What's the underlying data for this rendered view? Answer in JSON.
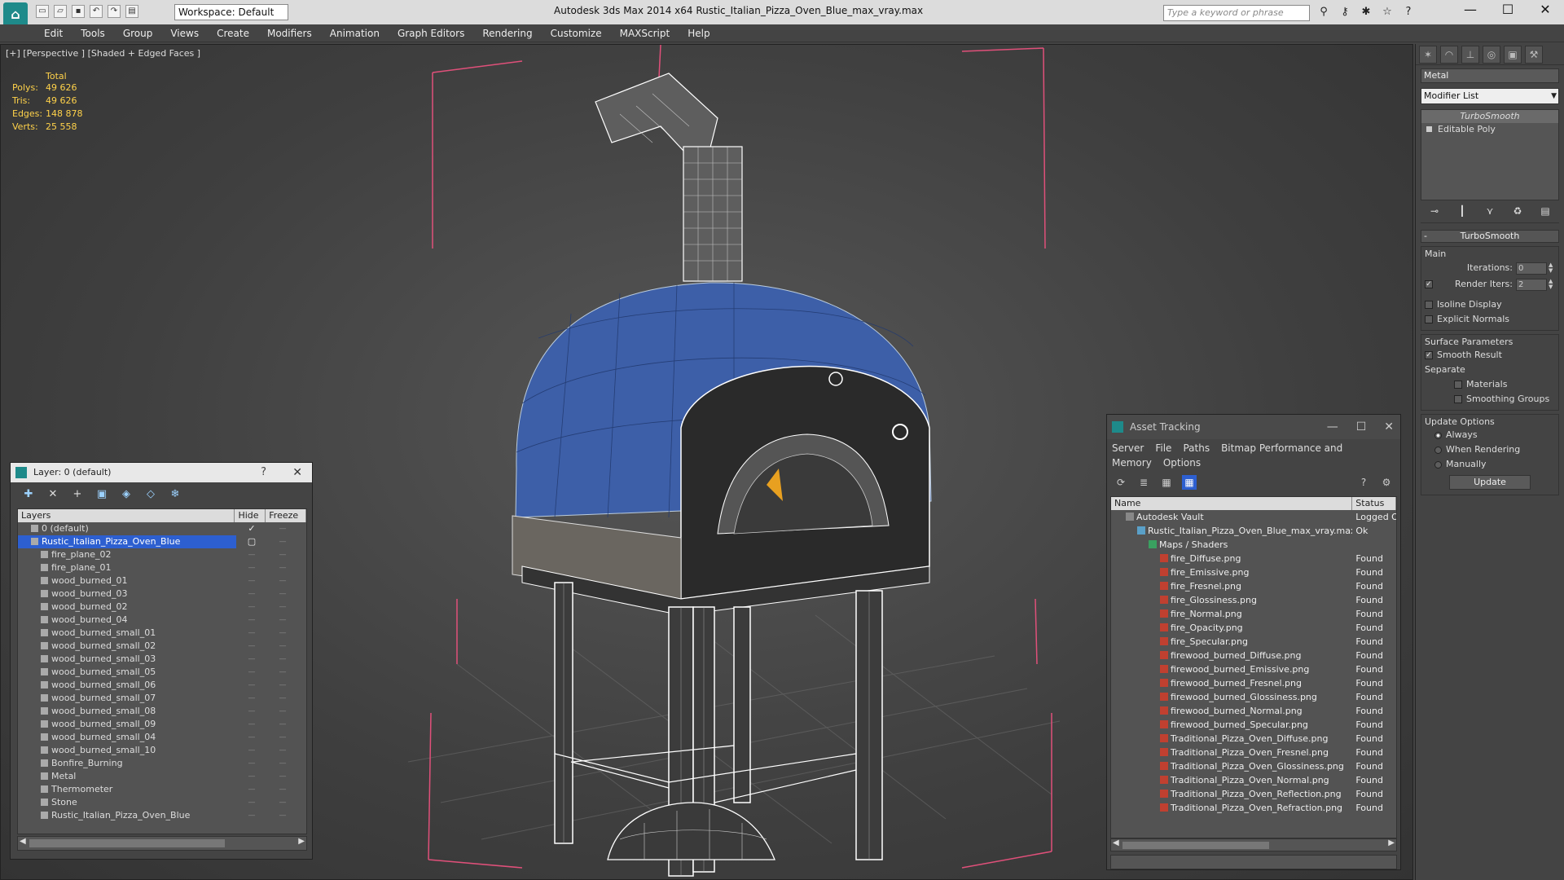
{
  "app": {
    "title": "Autodesk 3ds Max  2014 x64      Rustic_Italian_Pizza_Oven_Blue_max_vray.max",
    "workspace": "Workspace: Default",
    "search_placeholder": "Type a keyword or phrase"
  },
  "menu": [
    "Edit",
    "Tools",
    "Group",
    "Views",
    "Create",
    "Modifiers",
    "Animation",
    "Graph Editors",
    "Rendering",
    "Customize",
    "MAXScript",
    "Help"
  ],
  "viewport": {
    "label": "[+] [Perspective ] [Shaded + Edged Faces ]",
    "stats": {
      "header": "Total",
      "rows": [
        {
          "k": "Polys:",
          "v": "49 626"
        },
        {
          "k": "Tris:",
          "v": "49 626"
        },
        {
          "k": "Edges:",
          "v": "148 878"
        },
        {
          "k": "Verts:",
          "v": "25 558"
        }
      ]
    }
  },
  "command_panel": {
    "object_name": "Metal",
    "modifier_list": "Modifier List",
    "stack": [
      "TurboSmooth",
      "Editable Poly"
    ],
    "rollout": "TurboSmooth",
    "main_label": "Main",
    "iterations_label": "Iterations:",
    "iterations_value": "0",
    "render_iters_label": "Render Iters:",
    "render_iters_value": "2",
    "isoline": "Isoline Display",
    "explicit": "Explicit Normals",
    "surface_label": "Surface Parameters",
    "smooth_result": "Smooth Result",
    "separate": "Separate",
    "materials": "Materials",
    "smoothing_groups": "Smoothing Groups",
    "update_label": "Update Options",
    "always": "Always",
    "when_rendering": "When Rendering",
    "manually": "Manually",
    "update_btn": "Update"
  },
  "layer_window": {
    "title": "Layer: 0 (default)",
    "help": "?",
    "close": "✕",
    "col_layers": "Layers",
    "col_hide": "Hide",
    "col_freeze": "Freeze",
    "rows": [
      {
        "name": "0 (default)",
        "indent": 1,
        "kind": "layer",
        "hide": "✓"
      },
      {
        "name": "Rustic_Italian_Pizza_Oven_Blue",
        "indent": 1,
        "kind": "layer",
        "selected": true,
        "hide": "▢"
      },
      {
        "name": "fire_plane_02",
        "indent": 2
      },
      {
        "name": "fire_plane_01",
        "indent": 2
      },
      {
        "name": "wood_burned_01",
        "indent": 2
      },
      {
        "name": "wood_burned_03",
        "indent": 2
      },
      {
        "name": "wood_burned_02",
        "indent": 2
      },
      {
        "name": "wood_burned_04",
        "indent": 2
      },
      {
        "name": "wood_burned_small_01",
        "indent": 2
      },
      {
        "name": "wood_burned_small_02",
        "indent": 2
      },
      {
        "name": "wood_burned_small_03",
        "indent": 2
      },
      {
        "name": "wood_burned_small_05",
        "indent": 2
      },
      {
        "name": "wood_burned_small_06",
        "indent": 2
      },
      {
        "name": "wood_burned_small_07",
        "indent": 2
      },
      {
        "name": "wood_burned_small_08",
        "indent": 2
      },
      {
        "name": "wood_burned_small_09",
        "indent": 2
      },
      {
        "name": "wood_burned_small_04",
        "indent": 2
      },
      {
        "name": "wood_burned_small_10",
        "indent": 2
      },
      {
        "name": "Bonfire_Burning",
        "indent": 2
      },
      {
        "name": "Metal",
        "indent": 2
      },
      {
        "name": "Thermometer",
        "indent": 2
      },
      {
        "name": "Stone",
        "indent": 2
      },
      {
        "name": "Rustic_Italian_Pizza_Oven_Blue",
        "indent": 2
      }
    ]
  },
  "asset_window": {
    "title": "Asset Tracking",
    "menu": [
      "Server",
      "File",
      "Paths",
      "Bitmap Performance and Memory",
      "Options"
    ],
    "col_name": "Name",
    "col_status": "Status",
    "rows": [
      {
        "name": "Autodesk Vault",
        "status": "Logged O",
        "indent": 1,
        "icon": "vault"
      },
      {
        "name": "Rustic_Italian_Pizza_Oven_Blue_max_vray.max",
        "status": "Ok",
        "indent": 2,
        "icon": "max"
      },
      {
        "name": "Maps / Shaders",
        "status": "",
        "indent": 3,
        "icon": "folder"
      },
      {
        "name": "fire_Diffuse.png",
        "status": "Found",
        "indent": 4,
        "icon": "png"
      },
      {
        "name": "fire_Emissive.png",
        "status": "Found",
        "indent": 4,
        "icon": "png"
      },
      {
        "name": "fire_Fresnel.png",
        "status": "Found",
        "indent": 4,
        "icon": "png"
      },
      {
        "name": "fire_Glossiness.png",
        "status": "Found",
        "indent": 4,
        "icon": "png"
      },
      {
        "name": "fire_Normal.png",
        "status": "Found",
        "indent": 4,
        "icon": "png"
      },
      {
        "name": "fire_Opacity.png",
        "status": "Found",
        "indent": 4,
        "icon": "png"
      },
      {
        "name": "fire_Specular.png",
        "status": "Found",
        "indent": 4,
        "icon": "png"
      },
      {
        "name": "firewood_burned_Diffuse.png",
        "status": "Found",
        "indent": 4,
        "icon": "png"
      },
      {
        "name": "firewood_burned_Emissive.png",
        "status": "Found",
        "indent": 4,
        "icon": "png"
      },
      {
        "name": "firewood_burned_Fresnel.png",
        "status": "Found",
        "indent": 4,
        "icon": "png"
      },
      {
        "name": "firewood_burned_Glossiness.png",
        "status": "Found",
        "indent": 4,
        "icon": "png"
      },
      {
        "name": "firewood_burned_Normal.png",
        "status": "Found",
        "indent": 4,
        "icon": "png"
      },
      {
        "name": "firewood_burned_Specular.png",
        "status": "Found",
        "indent": 4,
        "icon": "png"
      },
      {
        "name": "Traditional_Pizza_Oven_Diffuse.png",
        "status": "Found",
        "indent": 4,
        "icon": "png"
      },
      {
        "name": "Traditional_Pizza_Oven_Fresnel.png",
        "status": "Found",
        "indent": 4,
        "icon": "png"
      },
      {
        "name": "Traditional_Pizza_Oven_Glossiness.png",
        "status": "Found",
        "indent": 4,
        "icon": "png"
      },
      {
        "name": "Traditional_Pizza_Oven_Normal.png",
        "status": "Found",
        "indent": 4,
        "icon": "png"
      },
      {
        "name": "Traditional_Pizza_Oven_Reflection.png",
        "status": "Found",
        "indent": 4,
        "icon": "png"
      },
      {
        "name": "Traditional_Pizza_Oven_Refraction.png",
        "status": "Found",
        "indent": 4,
        "icon": "png"
      }
    ]
  },
  "colors": {
    "selection": "#2d5fd0",
    "stats": "#ffd24a",
    "dome": "#3d5fa8",
    "wire": "#ffffff",
    "bbox": "#e0507a"
  }
}
